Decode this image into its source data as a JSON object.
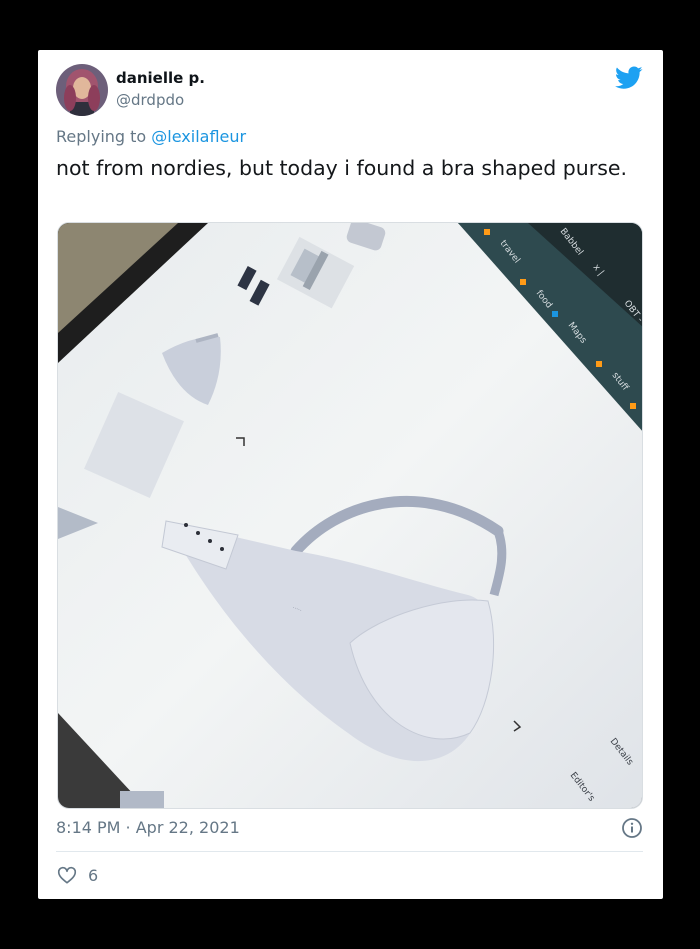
{
  "tweet": {
    "author_name": "danielle p.",
    "author_handle": "@drdpdo",
    "replying_prefix": "Replying to ",
    "replying_to": "@lexilafleur",
    "text": "not from nordies, but today i found a bra shaped purse.",
    "timestamp": "8:14 PM · Apr 22, 2021",
    "like_count": "6"
  },
  "screen_tabs": {
    "t1": "Babbel",
    "t2": "x |",
    "t3": "OBT -",
    "b1": "travel",
    "b2": "food",
    "b3": "Maps",
    "b4": "stuff"
  },
  "screen_labels": {
    "details": "Details",
    "editors": "Editor's"
  },
  "colors": {
    "accent": "#1da1f2",
    "link": "#1b95e0",
    "muted": "#657786",
    "text": "#14171a"
  },
  "icons": [
    "twitter-bird-icon",
    "info-icon",
    "heart-icon"
  ]
}
